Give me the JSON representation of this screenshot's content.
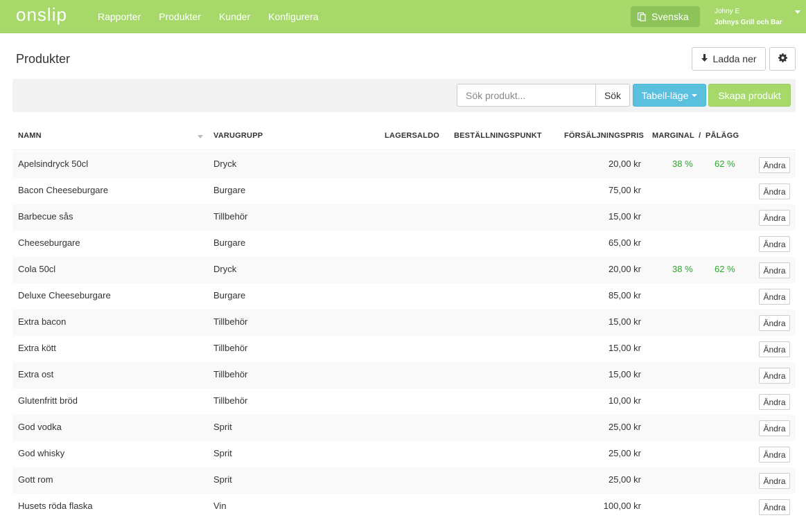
{
  "nav": {
    "logo": "onslip",
    "links": [
      "Rapporter",
      "Produkter",
      "Kunder",
      "Konfigurera"
    ],
    "language": "Svenska",
    "user_name": "Johny E",
    "company": "Johnys Grill och Bar"
  },
  "page": {
    "title": "Produkter",
    "download_label": "Ladda ner"
  },
  "toolbar": {
    "search_placeholder": "Sök produkt...",
    "search_label": "Sök",
    "mode_label": "Tabell-läge",
    "create_label": "Skapa produkt"
  },
  "table": {
    "headers": {
      "name": "NAMN",
      "group": "VARUGRUPP",
      "stock": "LAGERSALDO",
      "reorder": "BESTÄLLNINGSPUNKT",
      "price": "FÖRSÄLJNINGSPRIS",
      "margin_markup": "MARGINAL  /  PÅLÄGG"
    },
    "edit_label": "Ändra",
    "rows": [
      {
        "name": "Apelsindryck 50cl",
        "group": "Dryck",
        "price": "20,00 kr",
        "margin": "38 %",
        "markup": "62 %"
      },
      {
        "name": "Bacon Cheeseburgare",
        "group": "Burgare",
        "price": "75,00 kr",
        "margin": "",
        "markup": ""
      },
      {
        "name": "Barbecue sås",
        "group": "Tillbehör",
        "price": "15,00 kr",
        "margin": "",
        "markup": ""
      },
      {
        "name": "Cheeseburgare",
        "group": "Burgare",
        "price": "65,00 kr",
        "margin": "",
        "markup": ""
      },
      {
        "name": "Cola 50cl",
        "group": "Dryck",
        "price": "20,00 kr",
        "margin": "38 %",
        "markup": "62 %"
      },
      {
        "name": "Deluxe Cheeseburgare",
        "group": "Burgare",
        "price": "85,00 kr",
        "margin": "",
        "markup": ""
      },
      {
        "name": "Extra bacon",
        "group": "Tillbehör",
        "price": "15,00 kr",
        "margin": "",
        "markup": ""
      },
      {
        "name": "Extra kött",
        "group": "Tillbehör",
        "price": "15,00 kr",
        "margin": "",
        "markup": ""
      },
      {
        "name": "Extra ost",
        "group": "Tillbehör",
        "price": "15,00 kr",
        "margin": "",
        "markup": ""
      },
      {
        "name": "Glutenfritt bröd",
        "group": "Tillbehör",
        "price": "10,00 kr",
        "margin": "",
        "markup": ""
      },
      {
        "name": "God vodka",
        "group": "Sprit",
        "price": "25,00 kr",
        "margin": "",
        "markup": ""
      },
      {
        "name": "God whisky",
        "group": "Sprit",
        "price": "25,00 kr",
        "margin": "",
        "markup": ""
      },
      {
        "name": "Gott rom",
        "group": "Sprit",
        "price": "25,00 kr",
        "margin": "",
        "markup": ""
      },
      {
        "name": "Husets röda flaska",
        "group": "Vin",
        "price": "100,00 kr",
        "margin": "",
        "markup": ""
      }
    ]
  },
  "colors": {
    "brand_green": "#a6d96a",
    "info_blue": "#5bc0de",
    "positive_green": "#2ea52e"
  },
  "icons": {
    "language": "language-icon",
    "download": "download-arrow-icon",
    "settings": "gear-icon",
    "user_menu": "caret-down-icon",
    "sort": "sort-caret-icon"
  }
}
